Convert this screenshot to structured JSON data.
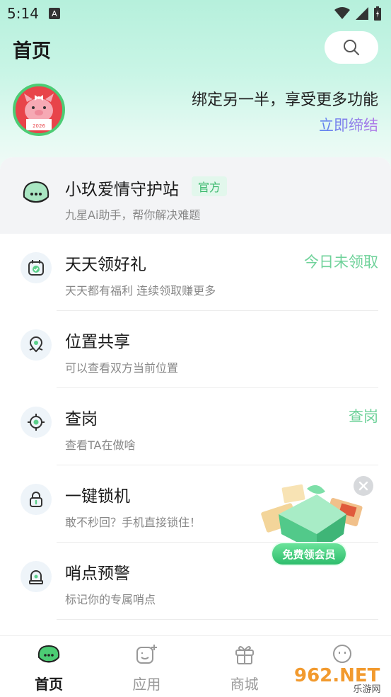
{
  "status_bar": {
    "time": "5:14",
    "notification_glyph": "A"
  },
  "header": {
    "title": "首页"
  },
  "profile": {
    "bind_text": "绑定另一半，享受更多功能",
    "bind_link": "立即缔结",
    "avatar_year": "2026"
  },
  "featured": {
    "title": "小玖爱情守护站",
    "badge": "官方",
    "subtitle": "九星Ai助手，帮你解决难题"
  },
  "items": [
    {
      "icon": "calendar-check-icon",
      "title": "天天领好礼",
      "subtitle": "天天都有福利 连续领取赚更多",
      "status": "今日未领取"
    },
    {
      "icon": "location-pin-icon",
      "title": "位置共享",
      "subtitle": "可以查看双方当前位置",
      "status": ""
    },
    {
      "icon": "target-icon",
      "title": "查岗",
      "subtitle": "查看TA在做啥",
      "status": "查岗"
    },
    {
      "icon": "lock-icon",
      "title": "一键锁机",
      "subtitle": "敢不秒回？手机直接锁住！",
      "status": ""
    },
    {
      "icon": "alarm-bell-icon",
      "title": "哨点预警",
      "subtitle": "标记你的专属哨点",
      "status": ""
    }
  ],
  "promo": {
    "label": "免费领会员"
  },
  "tabs": [
    {
      "label": "首页",
      "icon": "home-bubble-icon",
      "active": true
    },
    {
      "label": "应用",
      "icon": "apps-icon",
      "active": false
    },
    {
      "label": "商城",
      "icon": "gift-box-icon",
      "active": false
    },
    {
      "label": "",
      "icon": "profile-face-icon",
      "active": false
    }
  ],
  "watermark": {
    "brand": "962.NET",
    "sub": "乐游网"
  },
  "colors": {
    "accent_green": "#3cb96e",
    "status_green": "#6fd29a",
    "link_gradient_start": "#5a84f0",
    "link_gradient_end": "#b478e6",
    "hero_mint": "#b6f0dc"
  }
}
